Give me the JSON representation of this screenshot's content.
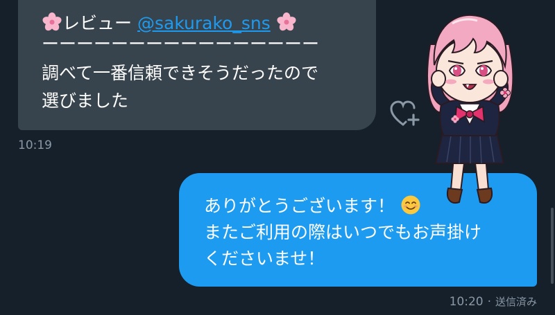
{
  "incoming": {
    "review_label": "レビュー",
    "mention": "@sakurako_sns",
    "divider": "ーーーーーーーーーーーーーーーー",
    "body_line1": "調べて一番信頼できそうだったので",
    "body_line2": "選びました",
    "time": "10:19"
  },
  "outgoing": {
    "line1": "ありがとうございます！",
    "line2": "またご利用の際はいつでもお声掛け",
    "line3": "くださいませ！",
    "time": "10:20",
    "separator": "·",
    "status": "送信済み"
  },
  "icons": {
    "flower": "cherry-blossom-emoji",
    "smile": "smiling-face-emoji",
    "reaction": "add-reaction-heart-icon",
    "sticker": "anime-girl-sticker"
  },
  "colors": {
    "background": "#15202b",
    "incoming_bubble": "#38444d",
    "outgoing_bubble": "#1d9bf0",
    "mention": "#1d9bf0",
    "timestamp": "#8b98a5"
  }
}
